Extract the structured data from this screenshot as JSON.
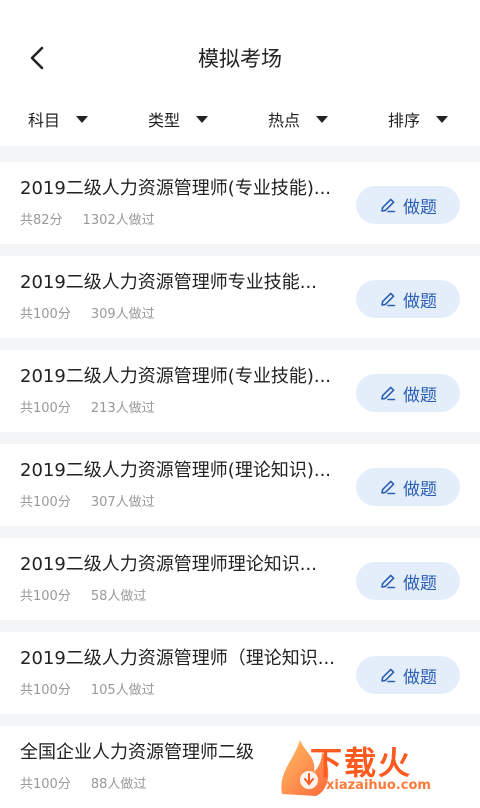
{
  "header": {
    "title": "模拟考场"
  },
  "filters": [
    {
      "label": "科目"
    },
    {
      "label": "类型"
    },
    {
      "label": "热点"
    },
    {
      "label": "排序"
    }
  ],
  "exams": [
    {
      "title": "2019二级人力资源管理师(专业技能)...",
      "score": "共82分",
      "count": "1302人做过",
      "button": "做题"
    },
    {
      "title": "2019二级人力资源管理师专业技能...",
      "score": "共100分",
      "count": "309人做过",
      "button": "做题"
    },
    {
      "title": "2019二级人力资源管理师(专业技能)...",
      "score": "共100分",
      "count": "213人做过",
      "button": "做题"
    },
    {
      "title": "2019二级人力资源管理师(理论知识)...",
      "score": "共100分",
      "count": "307人做过",
      "button": "做题"
    },
    {
      "title": "2019二级人力资源管理师理论知识...",
      "score": "共100分",
      "count": "58人做过",
      "button": "做题"
    },
    {
      "title": "2019二级人力资源管理师（理论知识...",
      "score": "共100分",
      "count": "105人做过",
      "button": "做题"
    },
    {
      "title": "全国企业人力资源管理师二级",
      "score": "共100分",
      "count": "88人做过",
      "button": ""
    }
  ],
  "watermark": {
    "text": "下载火",
    "sub": "xiazaihuo.com"
  },
  "colors": {
    "accent": "#2b5fb5",
    "button_bg": "#e4eefb",
    "watermark": "#ff5a1f"
  }
}
